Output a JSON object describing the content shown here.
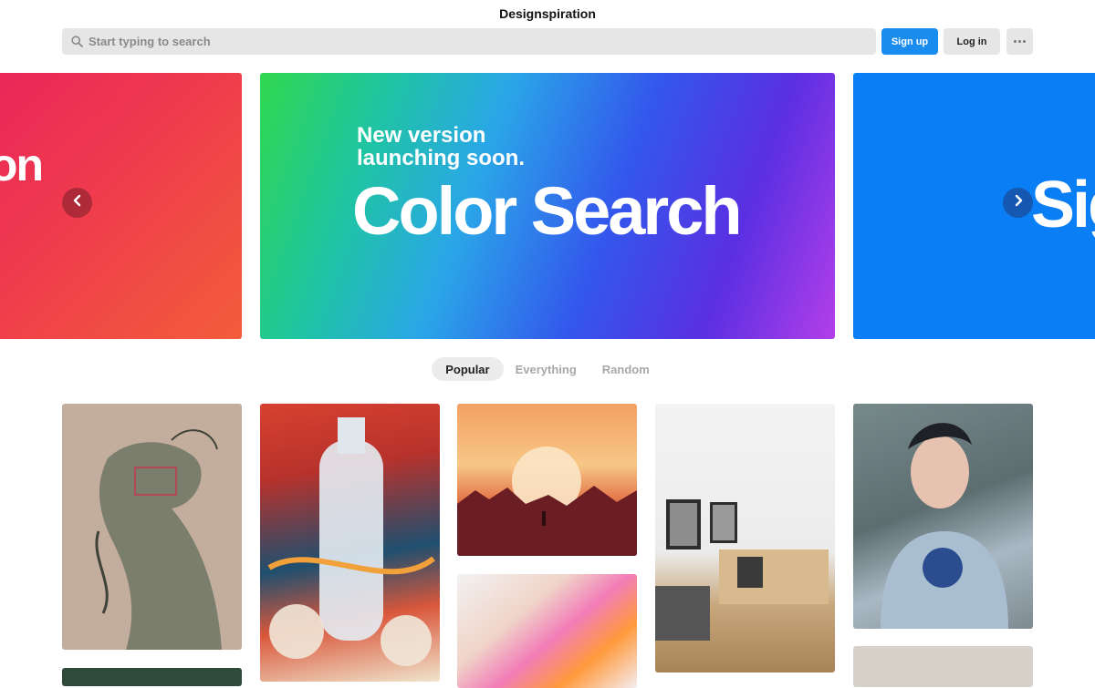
{
  "header": {
    "title": "Designspiration",
    "search_placeholder": "Start typing to search",
    "signup_label": "Sign up",
    "login_label": "Log in",
    "more_icon": "more-dots-icon",
    "search_icon": "search-icon"
  },
  "carousel": {
    "prev_slide_text": "on",
    "main_slide": {
      "subtitle_line1": "New version",
      "subtitle_line2": "launching soon.",
      "title": "Color Search"
    },
    "next_slide_text": "Sig",
    "prev_arrow_icon": "chevron-left-icon",
    "next_arrow_icon": "chevron-right-icon"
  },
  "tabs": [
    {
      "label": "Popular",
      "active": true
    },
    {
      "label": "Everything",
      "active": false
    },
    {
      "label": "Random",
      "active": false
    }
  ],
  "colors": {
    "accent": "#1a8cf0",
    "prev_slide": "#ef3b4d",
    "next_slide": "#0a7ef5"
  }
}
